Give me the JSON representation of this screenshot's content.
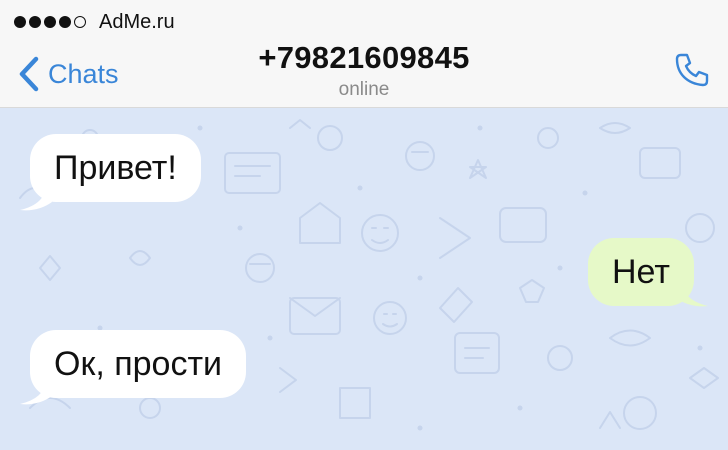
{
  "status_bar": {
    "signal_dots_filled": 4,
    "signal_dots_total": 5,
    "carrier": "AdMe.ru"
  },
  "header": {
    "back_label": "Chats",
    "back_icon": "chevron-left-icon",
    "title": "+79821609845",
    "subtitle": "online",
    "call_icon": "phone-icon",
    "accent_color": "#3a86d8"
  },
  "chat": {
    "background_color": "#dbe6f7",
    "messages": [
      {
        "direction": "incoming",
        "text": "Привет!"
      },
      {
        "direction": "outgoing",
        "text": "Нет"
      },
      {
        "direction": "incoming",
        "text": "Ок, прости"
      }
    ],
    "incoming_bubble_color": "#ffffff",
    "outgoing_bubble_color": "#e6f9c8"
  }
}
